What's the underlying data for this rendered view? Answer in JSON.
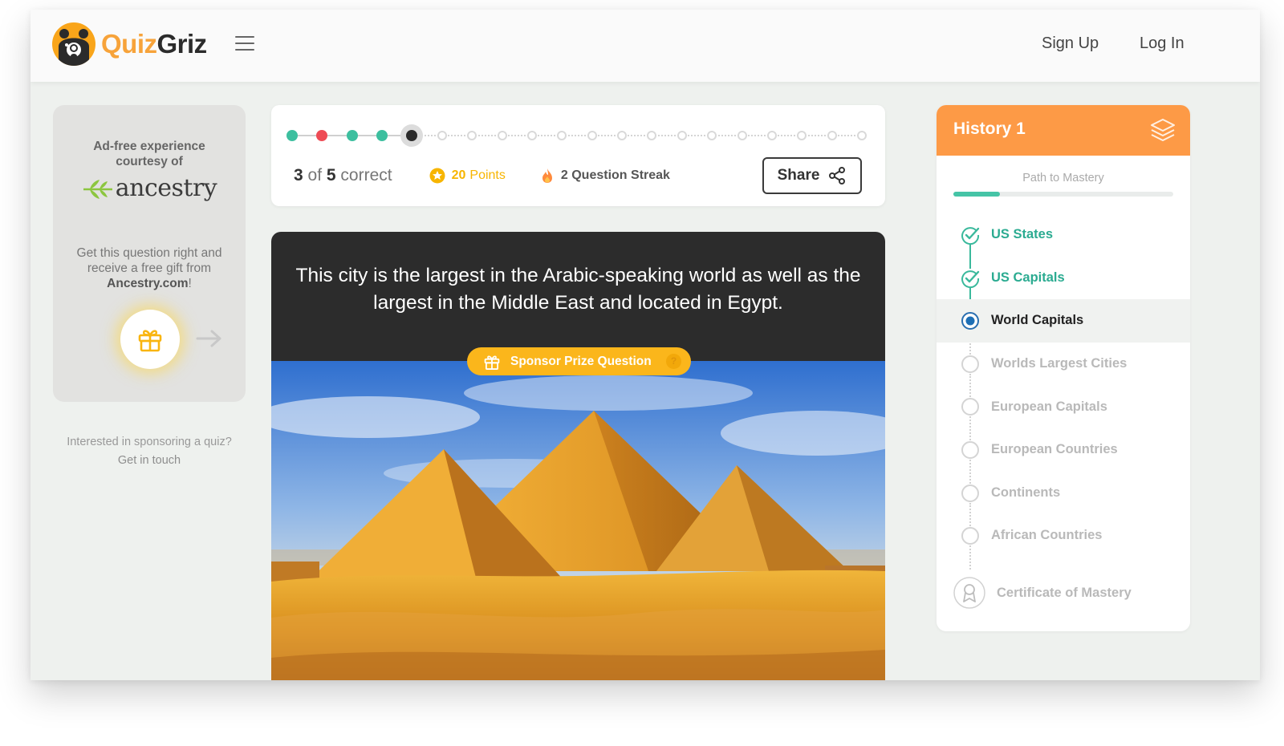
{
  "header": {
    "brand_part1": "Quiz",
    "brand_part2": "Griz",
    "signup": "Sign Up",
    "login": "Log In"
  },
  "sponsor": {
    "ad_free": "Ad-free experience courtesy of",
    "sponsor_name": "ancestry",
    "gift_text_before": "Get this question right and receive a free gift from",
    "gift_link": "Ancestry.com",
    "gift_text_after": "!",
    "cta_line1": "Interested in sponsoring a quiz?",
    "cta_line2": "Get in touch"
  },
  "progress": {
    "total_dots": 20,
    "answers": [
      "correct",
      "wrong",
      "correct",
      "correct"
    ],
    "current_index": 4,
    "score_correct": "3",
    "score_of": "of",
    "score_total": "5",
    "score_suffix": "correct",
    "points_value": "20",
    "points_label": "Points",
    "streak_value": "2",
    "streak_label": "Question Streak",
    "share_label": "Share"
  },
  "question": {
    "text": "This city is the largest in the Arabic-speaking world as well as the largest in the Middle East and located in Egypt.",
    "prize_label": "Sponsor Prize Question",
    "prize_help": "?"
  },
  "mastery": {
    "title": "History 1",
    "path_label": "Path to Mastery",
    "progress_fraction": 0.21,
    "items": [
      {
        "label": "US States",
        "status": "done"
      },
      {
        "label": "US Capitals",
        "status": "done"
      },
      {
        "label": "World Capitals",
        "status": "current"
      },
      {
        "label": "Worlds Largest Cities",
        "status": "todo"
      },
      {
        "label": "European Capitals",
        "status": "todo"
      },
      {
        "label": "European Countries",
        "status": "todo"
      },
      {
        "label": "Continents",
        "status": "todo"
      },
      {
        "label": "African Countries",
        "status": "todo"
      }
    ],
    "certificate": "Certificate of Mastery"
  },
  "colors": {
    "brand_orange": "#f7a33a",
    "correct": "#3dbf9f",
    "wrong": "#ee4b55",
    "points": "#f7b500",
    "header_orange": "#fd9a46",
    "prize_yellow": "#fbb61b"
  },
  "icons": {
    "logo": "bear-monocle-icon",
    "menu": "hamburger-icon",
    "points": "star-icon",
    "streak": "flame-icon",
    "share": "share-icon",
    "gift": "gift-icon",
    "arrow": "arrow-right-icon",
    "mastery_header": "layers-icon",
    "certificate": "ribbon-icon"
  }
}
